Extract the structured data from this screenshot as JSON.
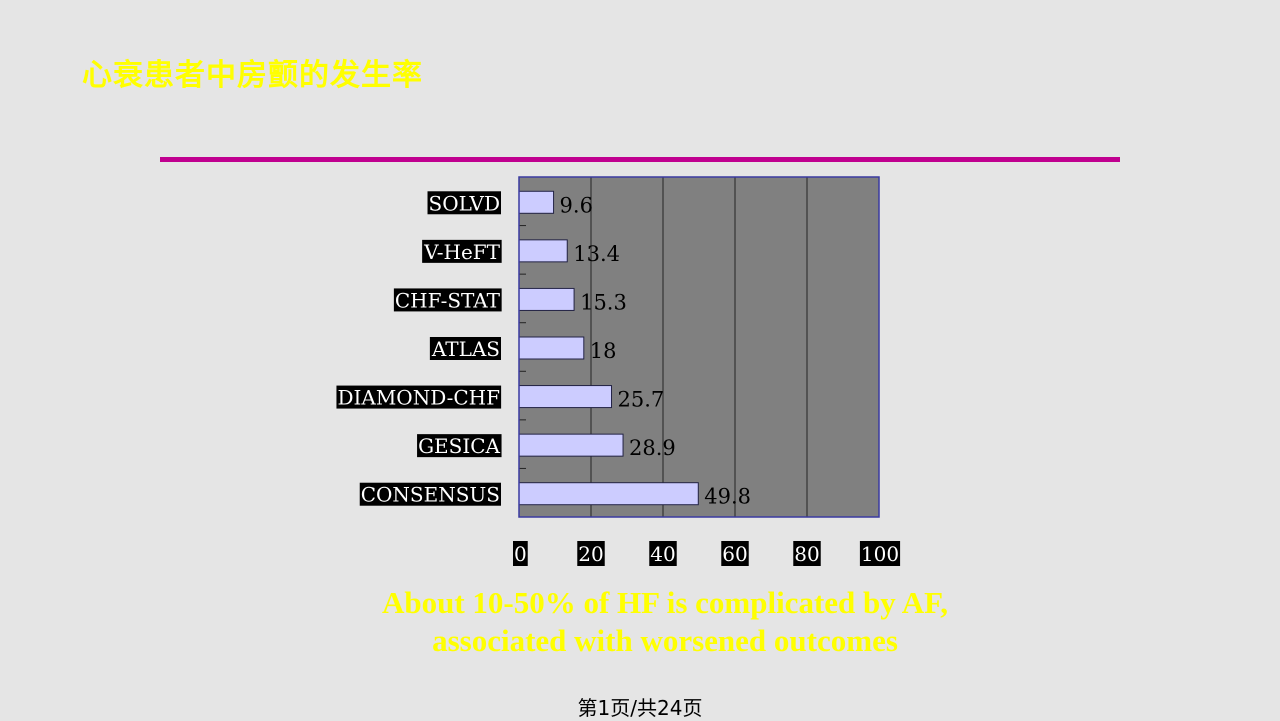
{
  "slide": {
    "title": "心衰患者中房颤的发生率",
    "caption_line1": "About 10-50% of HF is complicated by AF,",
    "caption_line2": "associated with worsened outcomes",
    "footer": "第1页/共24页",
    "colors": {
      "title": "#ffff00",
      "rule": "#c0008f",
      "plot_bg": "#808080",
      "bar_fill": "#ccccff",
      "plot_border": "#3a3aa0",
      "label_bg": "#000000",
      "label_text": "#ffffff"
    }
  },
  "chart_data": {
    "type": "bar",
    "orientation": "horizontal",
    "title": "",
    "xlabel": "",
    "ylabel": "",
    "categories": [
      "SOLVD",
      "V-HeFT",
      "CHF-STAT",
      "ATLAS",
      "DIAMOND-CHF",
      "GESICA",
      "CONSENSUS"
    ],
    "values": [
      9.6,
      13.4,
      15.3,
      18,
      25.7,
      28.9,
      49.8
    ],
    "value_labels": [
      "9.6",
      "13.4",
      "15.3",
      "18",
      "25.7",
      "28.9",
      "49.8"
    ],
    "xlim": [
      0,
      100
    ],
    "xticks": [
      0,
      20,
      40,
      60,
      80,
      100
    ],
    "xtick_labels": [
      "0",
      "20",
      "40",
      "60",
      "80",
      "100"
    ],
    "grid": "vertical",
    "legend": "none"
  }
}
